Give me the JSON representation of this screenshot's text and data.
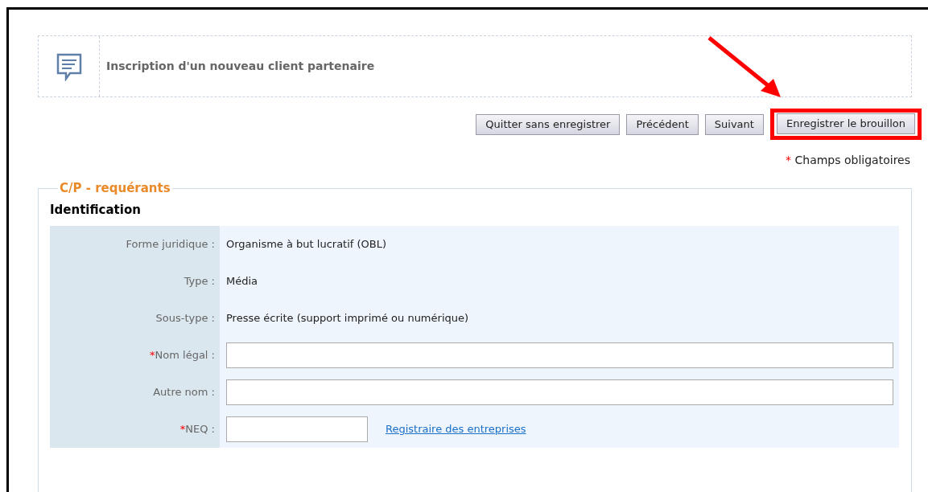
{
  "header": {
    "title": "Inscription d'un nouveau client partenaire"
  },
  "buttons": [
    {
      "label": "Quitter sans enregistrer",
      "highlighted": false
    },
    {
      "label": "Précédent",
      "highlighted": false
    },
    {
      "label": "Suivant",
      "highlighted": false
    },
    {
      "label": "Enregistrer le brouillon",
      "highlighted": true
    }
  ],
  "required_note": {
    "mark": "*",
    "text": "Champs obligatoires"
  },
  "section": {
    "legend": "C/P - requérants",
    "heading": "Identification",
    "rows": [
      {
        "kind": "text",
        "label": "Forme juridique :",
        "value": "Organisme à but lucratif (OBL)"
      },
      {
        "kind": "text",
        "label": "Type :",
        "value": "Média"
      },
      {
        "kind": "text",
        "label": "Sous-type :",
        "value": "Presse écrite (support imprimé ou numérique)"
      },
      {
        "kind": "input",
        "label": "Nom légal :",
        "mark": "*"
      },
      {
        "kind": "input",
        "label": "Autre nom :"
      },
      {
        "kind": "short-input",
        "label": "NEQ :",
        "mark": "*",
        "link": "Registraire des entreprises"
      }
    ]
  }
}
